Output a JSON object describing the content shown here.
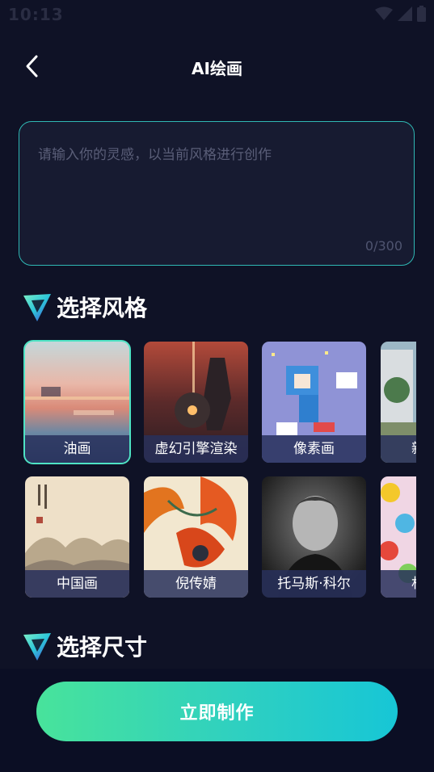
{
  "status": {
    "time": "10:13"
  },
  "header": {
    "title": "AI绘画"
  },
  "prompt": {
    "placeholder": "请输入你的灵感，以当前风格进行创作",
    "value": "",
    "count": "0/300"
  },
  "sections": {
    "style_title": "选择风格",
    "size_title": "选择尺寸"
  },
  "styles": [
    {
      "label": "油画",
      "selected": true
    },
    {
      "label": "虚幻引擎渲染",
      "selected": false
    },
    {
      "label": "像素画",
      "selected": false
    },
    {
      "label": "新",
      "selected": false
    },
    {
      "label": "中国画",
      "selected": false
    },
    {
      "label": "倪传婧",
      "selected": false
    },
    {
      "label": "托马斯·科尔",
      "selected": false
    },
    {
      "label": "村",
      "selected": false
    }
  ],
  "actions": {
    "make": "立即制作"
  },
  "colors": {
    "accent": "#2fb8b4",
    "button_start": "#48e39b",
    "button_end": "#17c6d6",
    "background": "#0f1226"
  }
}
